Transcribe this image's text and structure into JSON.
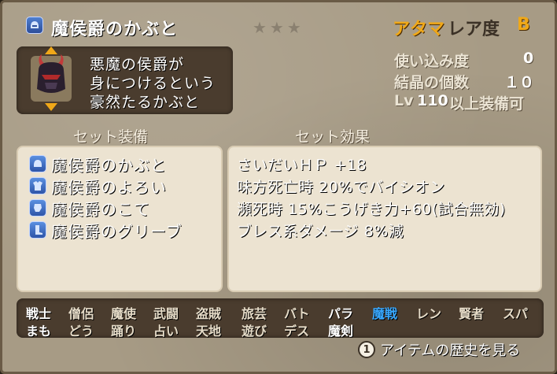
{
  "header": {
    "title": "魔侯爵のかぶと",
    "stars": "★★★",
    "category": "アタマ",
    "rarity_label": "レア度",
    "rarity_value": "B"
  },
  "item": {
    "description": [
      "悪魔の侯爵が",
      "身につけるという",
      "豪然たるかぶと"
    ]
  },
  "stats": {
    "usage_label": "使い込み度",
    "usage_value": "0",
    "crystal_label": "結晶の個数",
    "crystal_value": "１０",
    "level_prefix": "Lv",
    "level_value": "110",
    "level_suffix": "以上装備可"
  },
  "set": {
    "equipment_heading": "セット装備",
    "effect_heading": "セット効果",
    "items": [
      {
        "label": "魔侯爵のかぶと",
        "icon": "helmet-icon"
      },
      {
        "label": "魔侯爵のよろい",
        "icon": "armor-icon"
      },
      {
        "label": "魔侯爵のこて",
        "icon": "gauntlet-icon"
      },
      {
        "label": "魔侯爵のグリーブ",
        "icon": "greaves-icon"
      }
    ],
    "effects": [
      "さいだいＨＰ +18",
      "味方死亡時 20%でバイシオン",
      "瀕死時 15%こうげき力+60(試合無効)",
      "ブレス系ダメージ 8%減"
    ]
  },
  "jobs": {
    "row1": [
      "戦士",
      "僧侶",
      "魔使",
      "武闘",
      "盗賊",
      "旅芸",
      "バト",
      "パラ",
      "魔戦",
      "レン",
      "賢者",
      "スパ"
    ],
    "row2": [
      "まも",
      "どう",
      "踊り",
      "占い",
      "天地",
      "遊び",
      "デス",
      "魔剣"
    ]
  },
  "footer": {
    "button_glyph": "1",
    "history_label": "アイテムの歴史を見る"
  },
  "colors": {
    "accent": "#f0a818",
    "highlight_job": "#38a8ff"
  }
}
